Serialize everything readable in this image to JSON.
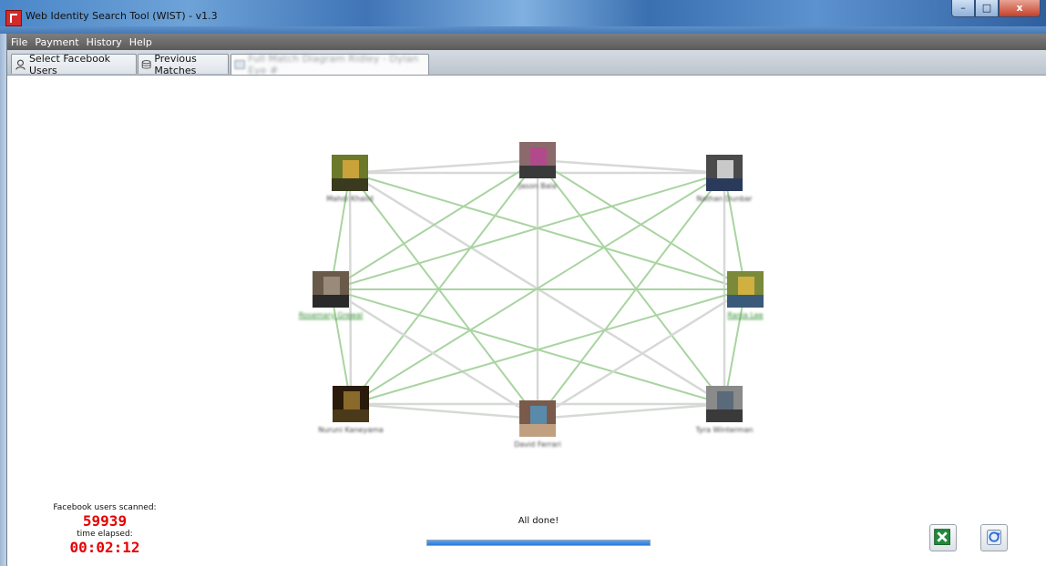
{
  "window": {
    "title": "Web Identity Search Tool (WIST) - v1.3",
    "buttons": {
      "minimize": "–",
      "maximize": "□",
      "close": "x"
    }
  },
  "menu": {
    "items": [
      "File",
      "Payment",
      "History",
      "Help"
    ]
  },
  "tabs": [
    {
      "label": "Select Facebook Users",
      "icon": "user-search-icon"
    },
    {
      "label": "Previous Matches",
      "icon": "database-icon"
    },
    {
      "label": "Full Match Diagram Ridley - Dylan Eye #",
      "icon": "diagram-icon"
    }
  ],
  "graph": {
    "nodes": [
      {
        "label": "Mahdi Khalid",
        "green": false,
        "colors": [
          "#6b7a2a",
          "#c9a23a",
          "#3a3a1e"
        ]
      },
      {
        "label": "Jason Bala",
        "green": false,
        "colors": [
          "#8a6a6a",
          "#b04a8a",
          "#3a3a3a"
        ]
      },
      {
        "label": "Nathan Dunbar",
        "green": false,
        "colors": [
          "#4a4a4a",
          "#c9c9c9",
          "#2a3a5a"
        ]
      },
      {
        "label": "Rosemary Grewal",
        "green": true,
        "colors": [
          "#6a5a4a",
          "#9a8a7a",
          "#2a2a2a"
        ]
      },
      {
        "label": "Rania Lee",
        "green": true,
        "colors": [
          "#7a8a3a",
          "#d0b040",
          "#3a5a7a"
        ]
      },
      {
        "label": "Nuruni Kaneyama",
        "green": false,
        "colors": [
          "#2a1a0a",
          "#8a6a2a",
          "#4a3a1a"
        ]
      },
      {
        "label": "David Ferrari",
        "green": false,
        "colors": [
          "#7a5a4a",
          "#5a8aaa",
          "#c0a080"
        ]
      },
      {
        "label": "Tyra Winterman",
        "green": false,
        "colors": [
          "#8a8a8a",
          "#5a6a7a",
          "#3a3a3a"
        ]
      }
    ]
  },
  "stats": {
    "scanned_label": "Facebook users scanned:",
    "scanned_value": "59939",
    "elapsed_label": "time elapsed:",
    "elapsed_value": "00:02:12"
  },
  "status": {
    "text": "All done!",
    "progress": 1.0
  },
  "actions": {
    "excel_icon": "excel-export-icon",
    "refresh_icon": "browser-refresh-icon"
  }
}
